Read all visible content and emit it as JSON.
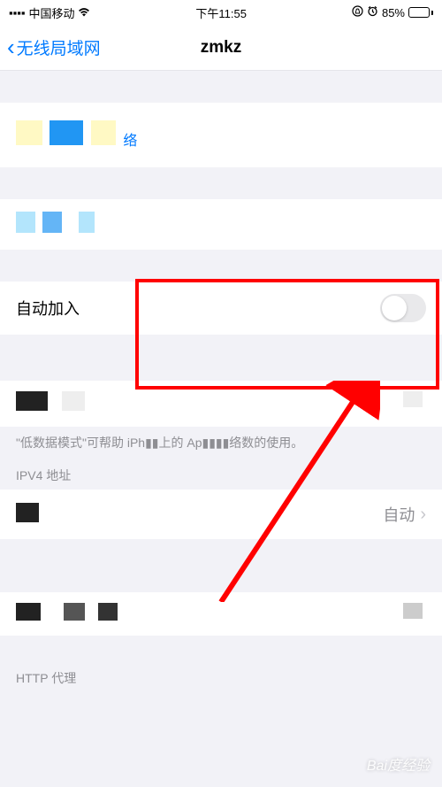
{
  "statusBar": {
    "carrier": "中国移动",
    "time": "下午11:55",
    "batteryPercent": "85%"
  },
  "nav": {
    "backLabel": "无线局域网",
    "title": "zmkz"
  },
  "autoJoin": {
    "label": "自动加入"
  },
  "lowDataFooter": "\"低数据模式\"可帮助 iPh▮▮上的 Ap▮▮▮▮络数的使用。",
  "ipv4": {
    "header": "IPV4 地址",
    "configValue": "自动"
  },
  "httpProxy": {
    "header": "HTTP 代理"
  },
  "watermark": "Bai度经验"
}
